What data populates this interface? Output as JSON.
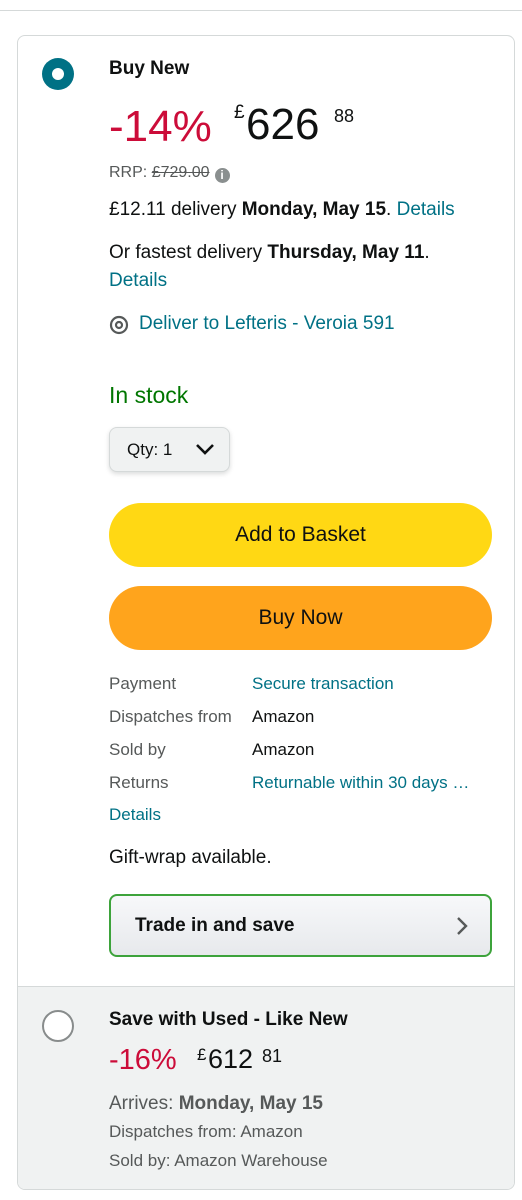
{
  "buy_new": {
    "title": "Buy New",
    "discount": "-14%",
    "currency": "£",
    "price_whole": "626",
    "price_fraction": "88",
    "rrp_label": "RRP:",
    "rrp_value": "£729.00",
    "delivery_prefix": "£12.11 delivery",
    "delivery_date": "Monday, May 15",
    "delivery_details": "Details",
    "fastest_prefix": "Or fastest delivery",
    "fastest_date": "Thursday, May 11",
    "fastest_details": "Details",
    "deliver_to": "Deliver to Lefteris - Veroia 591",
    "stock": "In stock",
    "qty_label": "Qty: 1",
    "add_to_basket": "Add to Basket",
    "buy_now": "Buy Now",
    "meta": [
      {
        "label": "Payment",
        "value": "Secure transaction"
      },
      {
        "label": "Dispatches from",
        "value": "Amazon"
      },
      {
        "label": "Sold by",
        "value": "Amazon"
      },
      {
        "label": "Returns",
        "value": "Returnable within 30 days …"
      }
    ],
    "returns_details": "Details",
    "gift_wrap": "Gift-wrap available.",
    "trade_in": "Trade in and save"
  },
  "used": {
    "title": "Save with Used - Like New",
    "discount": "-16%",
    "currency": "£",
    "price_whole": "612",
    "price_fraction": "81",
    "arrives_label": "Arrives:",
    "arrives_date": "Monday, May 15",
    "dispatches": "Dispatches from: Amazon",
    "sold_by": "Sold by: Amazon Warehouse"
  },
  "icons": [
    "radio-selected-icon",
    "info-icon",
    "location-pin-icon",
    "chevron-down-icon",
    "chevron-right-icon",
    "radio-unselected-icon"
  ],
  "colors": {
    "link": "#007185",
    "discount": "#cc0c39",
    "stock": "#007600",
    "basket": "#ffd814",
    "buy_now": "#ffa41c",
    "trade_border": "#3da33b"
  }
}
